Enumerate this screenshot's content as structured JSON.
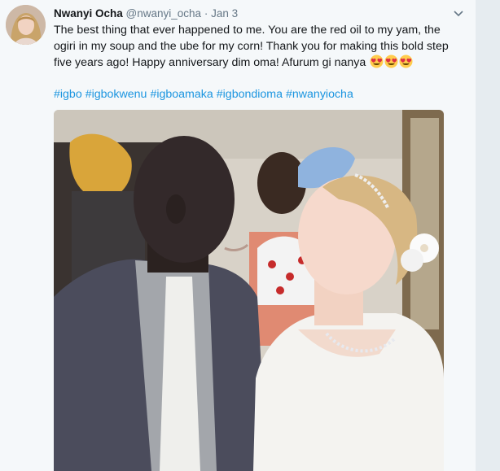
{
  "tweet": {
    "display_name": "Nwanyi Ocha",
    "handle": "@nwanyi_ocha",
    "separator": "·",
    "date": "Jan 3",
    "text_main": "The best thing that ever happened to me. You are the red oil to my yam, the ogiri in my soup and the ube for my corn! Thank you for making this bold step five years ago! Happy anniversary dim oma!  Afurum gi nanya ",
    "hashtags": [
      "#igbo",
      "#igbokwenu",
      "#igboamaka",
      "#igbondioma",
      "#nwanyiocha"
    ],
    "emoji_icon": "heart-eyes-emoji",
    "emoji_count": 3
  },
  "colors": {
    "background": "#f5f8fa",
    "text": "#14171a",
    "secondary": "#657786",
    "link": "#1b95e0"
  }
}
